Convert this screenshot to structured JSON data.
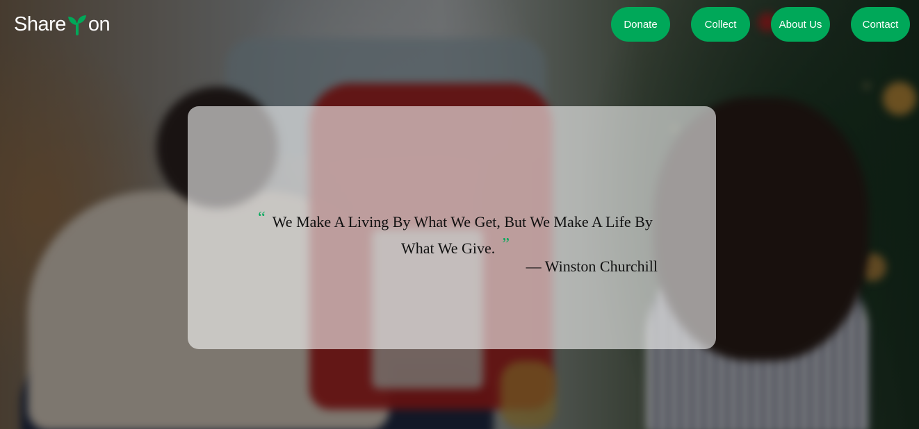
{
  "brand": {
    "logo_prefix": "Share",
    "logo_suffix": "on",
    "logo_icon": "sprout-icon",
    "accent_color": "#00a859"
  },
  "nav": {
    "items": [
      {
        "label": "Donate"
      },
      {
        "label": "Collect"
      },
      {
        "label": "About Us"
      },
      {
        "label": "Contact"
      }
    ]
  },
  "hero": {
    "quote": {
      "open_mark": "“",
      "text": "We Make A Living By What We Get, But We Make A Life By What We Give.",
      "close_mark": "”",
      "author": "— Winston Churchill"
    }
  }
}
